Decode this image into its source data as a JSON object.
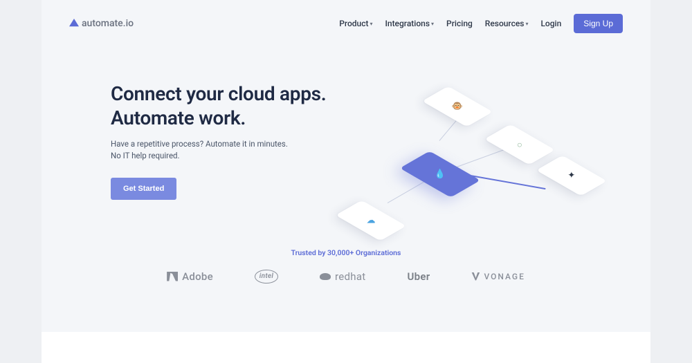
{
  "brand": {
    "name": "automate.io"
  },
  "nav": {
    "items": [
      {
        "label": "Product",
        "dropdown": true
      },
      {
        "label": "Integrations",
        "dropdown": true
      },
      {
        "label": "Pricing",
        "dropdown": false
      },
      {
        "label": "Resources",
        "dropdown": true
      },
      {
        "label": "Login",
        "dropdown": false
      }
    ],
    "signup": "Sign Up"
  },
  "hero": {
    "headline1": "Connect your cloud apps.",
    "headline2": "Automate work.",
    "sub1": "Have a repetitive process? Automate it in minutes.",
    "sub2": "No IT help required.",
    "cta": "Get Started"
  },
  "graphic": {
    "tiles": [
      {
        "name": "mailchimp-tile",
        "icon": "🐵"
      },
      {
        "name": "automate-center-tile",
        "icon": "💧"
      },
      {
        "name": "helpscout-tile",
        "icon": "○"
      },
      {
        "name": "sendgrid-tile",
        "icon": "✦"
      },
      {
        "name": "salesforce-tile",
        "icon": "☁"
      }
    ]
  },
  "trusted": {
    "title": "Trusted by 30,000+ Organizations",
    "brands": [
      "Adobe",
      "intel",
      "redhat",
      "Uber",
      "VONAGE"
    ]
  }
}
